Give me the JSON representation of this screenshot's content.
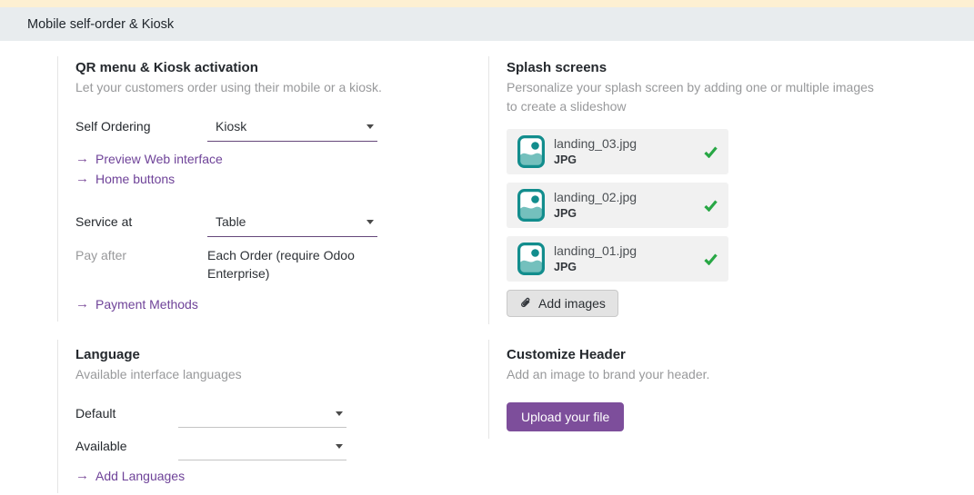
{
  "header": {
    "title": "Mobile self-order & Kiosk"
  },
  "icons": {
    "arrow": "→"
  },
  "qr_section": {
    "title": "QR menu & Kiosk activation",
    "subtitle": "Let your customers order using their mobile or a kiosk.",
    "fields": {
      "self_ordering": {
        "label": "Self Ordering",
        "value": "Kiosk"
      },
      "service_at": {
        "label": "Service at",
        "value": "Table"
      },
      "pay_after": {
        "label": "Pay after",
        "value": "Each Order (require Odoo Enterprise)"
      }
    },
    "links": [
      {
        "label": "Preview Web interface"
      },
      {
        "label": "Home buttons"
      },
      {
        "label": "Payment Methods"
      }
    ]
  },
  "language_section": {
    "title": "Language",
    "subtitle": "Available interface languages",
    "fields": {
      "default": {
        "label": "Default",
        "value": ""
      },
      "available": {
        "label": "Available",
        "value": ""
      }
    },
    "links": [
      {
        "label": "Add Languages"
      }
    ]
  },
  "splash_section": {
    "title": "Splash screens",
    "subtitle": "Personalize your splash screen by adding one or multiple images to create a slideshow",
    "files": [
      {
        "name": "landing_03.jpg",
        "type": "JPG"
      },
      {
        "name": "landing_02.jpg",
        "type": "JPG"
      },
      {
        "name": "landing_01.jpg",
        "type": "JPG"
      }
    ],
    "add_button_label": "Add images"
  },
  "customize_section": {
    "title": "Customize Header",
    "subtitle": "Add an image to brand your header.",
    "upload_button_label": "Upload your file"
  },
  "colors": {
    "accent_purple": "#7d4e9b",
    "link_purple": "#6f4399",
    "teal": "#128d8d",
    "success_green": "#28a745",
    "topbar_yellow": "#fdf0d2",
    "header_bar_gray": "#e8ecee"
  }
}
